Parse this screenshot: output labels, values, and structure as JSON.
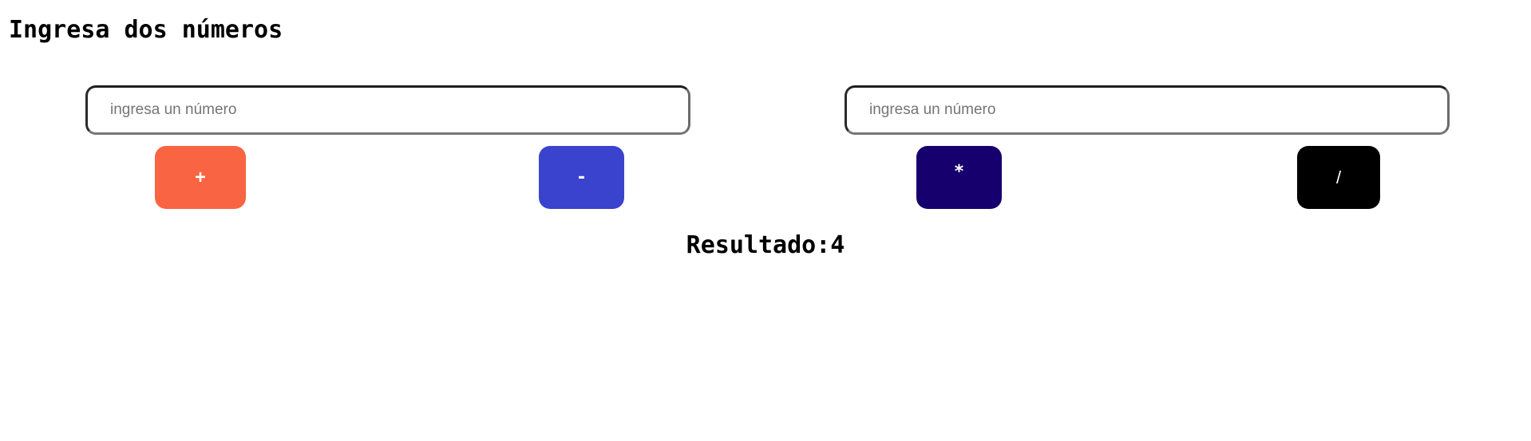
{
  "heading": "Ingresa dos números",
  "inputs": [
    {
      "value": "",
      "placeholder": "ingresa un número"
    },
    {
      "value": "",
      "placeholder": "ingresa un número"
    }
  ],
  "buttons": [
    {
      "label": "+",
      "color": "#F96442"
    },
    {
      "label": "-",
      "color": "#3A43CE"
    },
    {
      "label": "*",
      "color": "#16006E"
    },
    {
      "label": "/",
      "color": "#000000"
    }
  ],
  "result": {
    "label": "Resultado:",
    "value": "4"
  }
}
